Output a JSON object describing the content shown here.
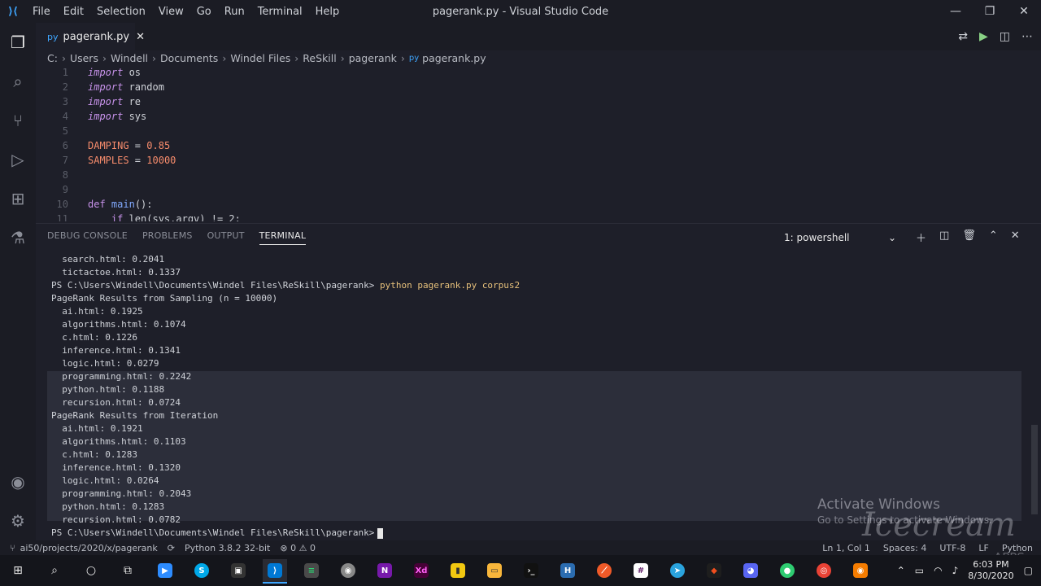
{
  "window": {
    "title": "pagerank.py - Visual Studio Code",
    "menu": [
      "File",
      "Edit",
      "Selection",
      "View",
      "Go",
      "Run",
      "Terminal",
      "Help"
    ],
    "controls": {
      "minimize": "—",
      "restore": "❐",
      "close": "✕"
    }
  },
  "activity_icons": [
    "explorer-icon",
    "search-icon",
    "source-control-icon",
    "run-debug-icon",
    "extensions-icon",
    "testing-icon",
    "account-icon",
    "settings-gear-icon"
  ],
  "tab": {
    "label": "pagerank.py",
    "lang_glyph": "py",
    "close": "✕"
  },
  "breadcrumb": [
    "C:",
    "Users",
    "Windell",
    "Documents",
    "Windel Files",
    "ReSkill",
    "pagerank",
    "pagerank.py"
  ],
  "code": [
    {
      "n": "1",
      "kw": "import",
      "rest": " os"
    },
    {
      "n": "2",
      "kw": "import",
      "rest": " random"
    },
    {
      "n": "3",
      "kw": "import",
      "rest": " re"
    },
    {
      "n": "4",
      "kw": "import",
      "rest": " sys"
    },
    {
      "n": "5"
    },
    {
      "n": "6",
      "name": "DAMPING",
      "op": " = ",
      "val": "0.85"
    },
    {
      "n": "7",
      "name": "SAMPLES",
      "op": " = ",
      "val": "10000"
    },
    {
      "n": "8"
    },
    {
      "n": "9"
    },
    {
      "n": "10",
      "kw": "def",
      "fn": " main",
      "rest": "():"
    },
    {
      "n": "11",
      "kw": "    if",
      "rest": " len(sys.argv) != 2:"
    }
  ],
  "panel": {
    "tabs": [
      "DEBUG CONSOLE",
      "PROBLEMS",
      "OUTPUT",
      "TERMINAL"
    ],
    "active_tab": "TERMINAL",
    "terminal_select": "1: powershell"
  },
  "terminal": {
    "prompt": "PS C:\\Users\\Windell\\Documents\\Windel Files\\ReSkill\\pagerank>",
    "command": "python pagerank.py corpus2",
    "pre_lines": [
      "  search.html: 0.2041",
      "  tictactoe.html: 0.1337"
    ],
    "sampling_header": "PageRank Results from Sampling (n = 10000)",
    "sampling": [
      "  ai.html: 0.1925",
      "  algorithms.html: 0.1074",
      "  c.html: 0.1226",
      "  inference.html: 0.1341",
      "  logic.html: 0.0279",
      "  programming.html: 0.2242",
      "  python.html: 0.1188",
      "  recursion.html: 0.0724"
    ],
    "iteration_header": "PageRank Results from Iteration",
    "iteration": [
      "  ai.html: 0.1921",
      "  algorithms.html: 0.1103",
      "  c.html: 0.1283",
      "  inference.html: 0.1320",
      "  logic.html: 0.0264",
      "  programming.html: 0.2043",
      "  python.html: 0.1283",
      "  recursion.html: 0.0782"
    ]
  },
  "status": {
    "remote": "ai50/projects/2020/x/pagerank",
    "python": "Python 3.8.2 32-bit",
    "problems": "⊗ 0 ⚠ 0",
    "right": [
      "Ln 1, Col 1",
      "Spaces: 4",
      "UTF-8",
      "LF",
      "Python"
    ]
  },
  "watermark": {
    "activate_title": "Activate Windows",
    "activate_sub": "Go to Settings to activate Windows.",
    "brand": "Icecream",
    "brand_sub": "APPS"
  },
  "taskbar": {
    "time": "6:03 PM",
    "date": "8/30/2020"
  }
}
